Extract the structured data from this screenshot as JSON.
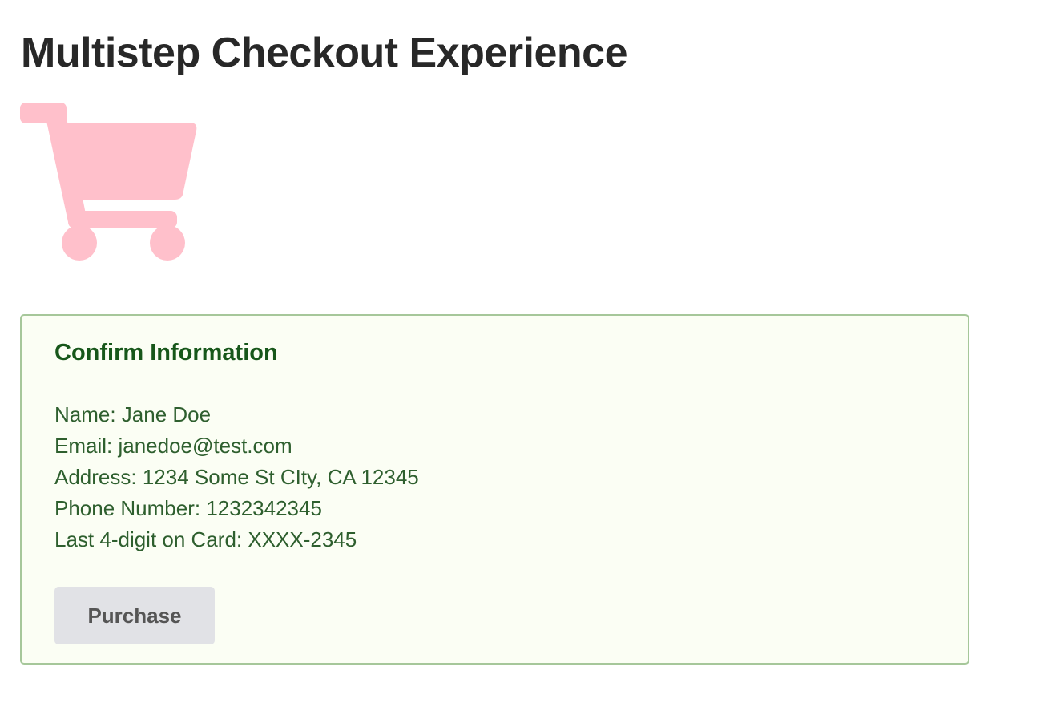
{
  "page": {
    "title": "Multistep Checkout Experience"
  },
  "cart_icon": {
    "name": "shopping-cart-icon",
    "color": "#ffc0cb"
  },
  "confirm": {
    "title": "Confirm Information",
    "lines": [
      "Name: Jane Doe",
      "Email: janedoe@test.com",
      "Address: 1234 Some St CIty, CA 12345",
      "Phone Number: 1232342345",
      "Last 4-digit on Card: XXXX-2345"
    ],
    "purchase_label": "Purchase"
  },
  "colors": {
    "panel_background": "#fbfef4",
    "panel_border": "#a6c79a",
    "heading_green": "#17571a",
    "text_green": "#2e5f2e",
    "button_background": "#e1e2e6"
  }
}
